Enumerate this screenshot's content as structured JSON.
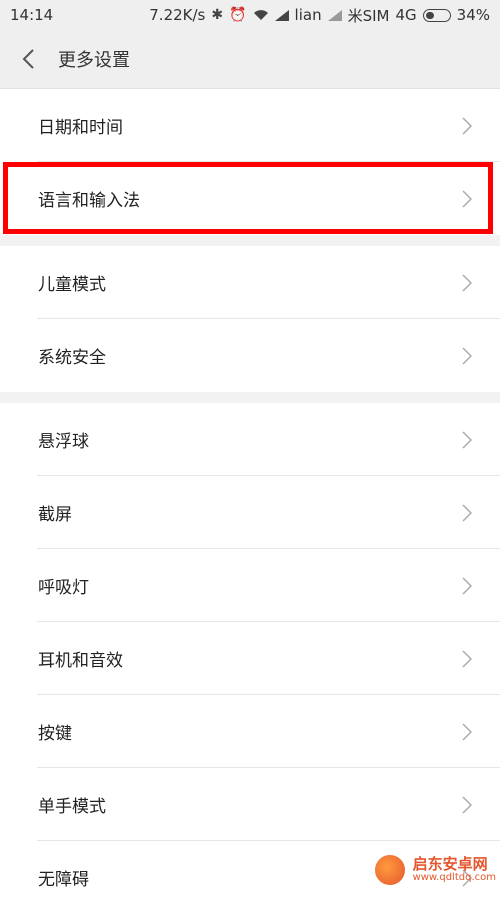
{
  "status_bar": {
    "time": "14:14",
    "speed": "7.22K/s",
    "carrier1": "lian",
    "carrier2": "米SIM",
    "network": "4G",
    "battery": "34%",
    "battery_level": 0.34
  },
  "header": {
    "title": "更多设置"
  },
  "groups": [
    {
      "items": [
        "日期和时间",
        "语言和输入法"
      ]
    },
    {
      "items": [
        "儿童模式",
        "系统安全"
      ]
    },
    {
      "items": [
        "悬浮球",
        "截屏",
        "呼吸灯",
        "耳机和音效",
        "按键",
        "单手模式",
        "无障碍"
      ]
    }
  ],
  "highlighted_item": "语言和输入法",
  "watermark": {
    "name": "启东安卓网",
    "url": "www.qdltdq.com"
  },
  "colors": {
    "highlight": "#ff0000",
    "background": "#f2f2f2",
    "accent": "#e4572e"
  }
}
